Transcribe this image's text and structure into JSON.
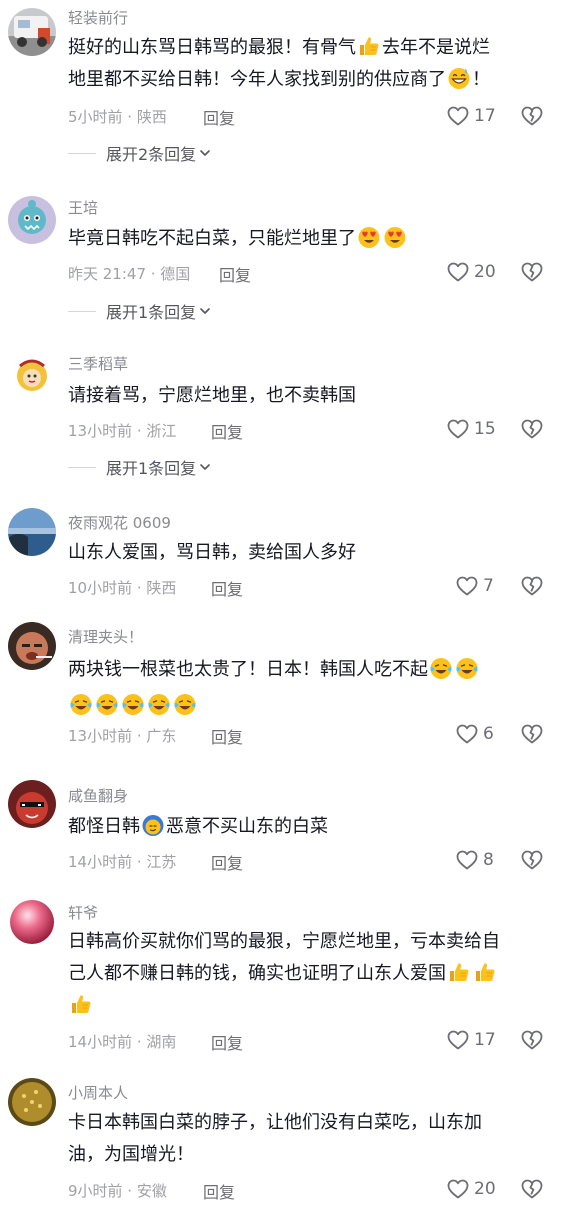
{
  "comments": [
    {
      "username": "轻装前行",
      "segments": [
        "挺好的山东骂日韩骂的最狠！有骨气",
        "去年不是说烂",
        "地里都不买给日韩！今年人家找到别的供应商了",
        "！"
      ],
      "time_location": "5小时前 · 陕西",
      "reply_label": "回复",
      "likes": "17",
      "expand_label": "展开2条回复"
    },
    {
      "username": "王培",
      "segments": [
        "毕竟日韩吃不起白菜，只能烂地里了"
      ],
      "time_location": "昨天 21:47 · 德国",
      "reply_label": "回复",
      "likes": "20",
      "expand_label": "展开1条回复"
    },
    {
      "username": "三季稻草",
      "segments": [
        "请接着骂，宁愿烂地里，也不卖韩国"
      ],
      "time_location": "13小时前 · 浙江",
      "reply_label": "回复",
      "likes": "15",
      "expand_label": "展开1条回复"
    },
    {
      "username": "夜雨观花 0609",
      "segments": [
        "山东人爱国，骂日韩，卖给国人多好"
      ],
      "time_location": "10小时前 · 陕西",
      "reply_label": "回复",
      "likes": "7"
    },
    {
      "username": "清理夹头！",
      "segments": [
        "两块钱一根菜也太贵了！日本！韩国人吃不起"
      ],
      "time_location": "13小时前 · 广东",
      "reply_label": "回复",
      "likes": "6"
    },
    {
      "username": "咸鱼翻身",
      "segments": [
        "都怪日韩",
        "恶意不买山东的白菜"
      ],
      "time_location": "14小时前 · 江苏",
      "reply_label": "回复",
      "likes": "8"
    },
    {
      "username": "轩爷",
      "segments": [
        "日韩高价买就你们骂的最狠，宁愿烂地里，亏本卖给自",
        "己人都不赚日韩的钱，确实也证明了山东人爱国"
      ],
      "time_location": "14小时前 · 湖南",
      "reply_label": "回复",
      "likes": "17"
    },
    {
      "username": "小周本人",
      "segments": [
        "卡日本韩国白菜的脖子，让他们没有白菜吃，山东加",
        "油，为国增光！"
      ],
      "time_location": "9小时前 · 安徽",
      "reply_label": "回复",
      "likes": "20"
    }
  ],
  "icons": {
    "like": "heart-outline-icon",
    "dislike": "broken-heart-icon",
    "expand": "chevron-down-icon",
    "emoji_thumbs": "thumbs-up-emoji-icon",
    "emoji_sweat": "grinning-sweat-emoji-icon",
    "emoji_heart_eyes": "heart-eyes-emoji-icon",
    "emoji_laugh_cry": "loudly-laughing-emoji-icon",
    "emoji_pointing": "sly-face-emoji-icon"
  },
  "colors": {
    "text_primary": "#161823",
    "text_secondary": "#8a8b91",
    "meta": "#a0a1a6",
    "icon_gray": "#6d6e74"
  }
}
